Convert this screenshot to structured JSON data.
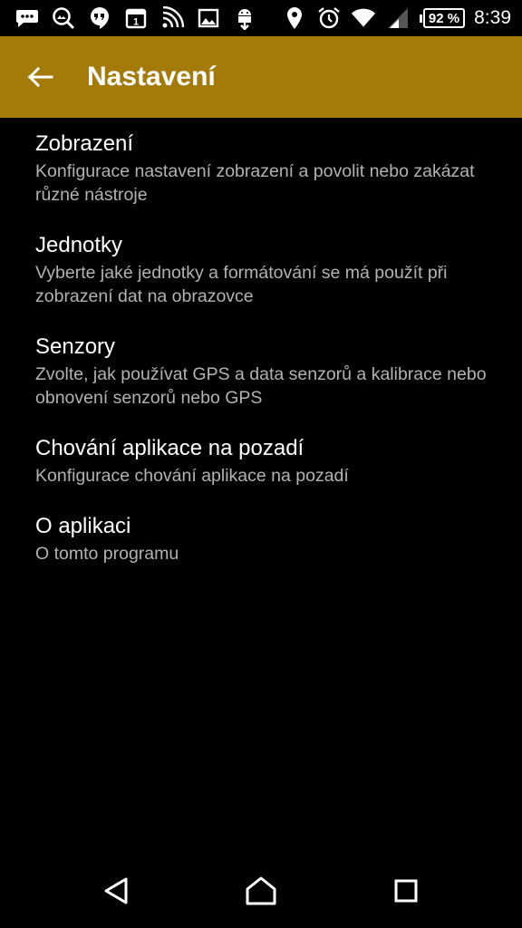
{
  "status_bar": {
    "icons_left": [
      "messages-icon",
      "image-search-icon",
      "hangouts-icon",
      "calendar-icon",
      "nfc-icon",
      "gallery-icon",
      "android-download-icon"
    ],
    "icons_right": [
      "location-icon",
      "alarm-icon",
      "wifi-icon",
      "signal-icon"
    ],
    "battery_percent": "92 %",
    "battery_level": 0.92,
    "time": "8:39"
  },
  "app_bar": {
    "title": "Nastavení",
    "background_color": "#a47a08",
    "back_icon": "arrow-left-icon"
  },
  "settings": [
    {
      "title": "Zobrazení",
      "summary": "Konfigurace nastavení zobrazení a povolit nebo zakázat různé nástroje"
    },
    {
      "title": "Jednotky",
      "summary": "Vyberte jaké jednotky a formátování se má použít při zobrazení dat na obrazovce"
    },
    {
      "title": "Senzory",
      "summary": "Zvolte, jak používat GPS a data senzorů a kalibrace nebo obnovení senzorů nebo GPS"
    },
    {
      "title": "Chování aplikace na pozadí",
      "summary": "Konfigurace chování aplikace na pozadí"
    },
    {
      "title": "O aplikaci",
      "summary": "O tomto programu"
    }
  ],
  "nav_bar": {
    "buttons": [
      "back-triangle-icon",
      "home-icon",
      "recents-icon"
    ]
  }
}
